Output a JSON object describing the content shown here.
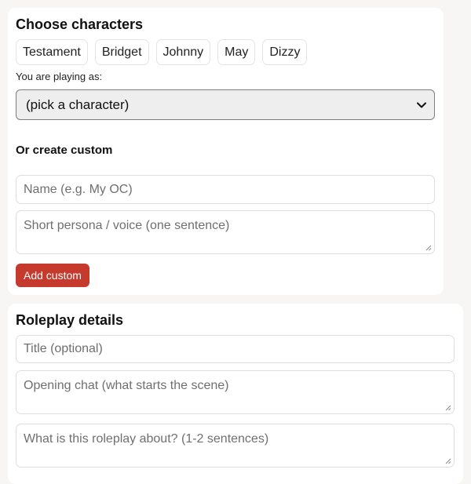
{
  "choose_characters": {
    "heading": "Choose characters",
    "characters": [
      "Testament",
      "Bridget",
      "Johnny",
      "May",
      "Dizzy"
    ],
    "playing_as_label": "You are playing as:",
    "playing_as_selected": "(pick a character)"
  },
  "create_custom": {
    "heading": "Or create custom",
    "name_placeholder": "Name (e.g. My OC)",
    "persona_placeholder": "Short persona / voice (one sentence)",
    "add_button": "Add custom"
  },
  "roleplay_details": {
    "heading": "Roleplay details",
    "title_placeholder": "Title (optional)",
    "opening_placeholder": "Opening chat (what starts the scene)",
    "about_placeholder": "What is this roleplay about? (1-2 sentences)"
  },
  "colors": {
    "accent": "#c53a2d",
    "page_background": "#f8f6f4",
    "card_background": "#ffffff"
  }
}
